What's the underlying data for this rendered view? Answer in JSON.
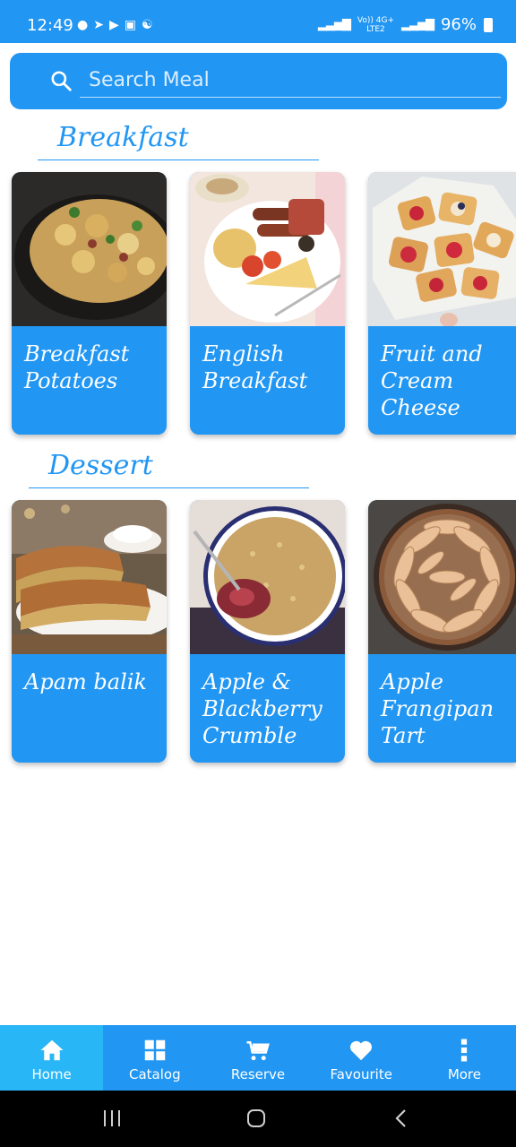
{
  "status_bar": {
    "time": "12:49",
    "battery": "96%",
    "network_top": "Vo)) 4G+",
    "network_bottom": "LTE2"
  },
  "search": {
    "placeholder": "Search Meal"
  },
  "sections": [
    {
      "title": "Breakfast",
      "meals": [
        {
          "name": "Breakfast Potatoes"
        },
        {
          "name": "English Breakfast"
        },
        {
          "name": "Fruit and Cream Cheese"
        }
      ]
    },
    {
      "title": "Dessert",
      "meals": [
        {
          "name": "Apam balik"
        },
        {
          "name": "Apple & Blackberry Crumble"
        },
        {
          "name": "Apple Frangipan Tart"
        }
      ]
    }
  ],
  "bottom_nav": {
    "items": [
      {
        "label": "Home",
        "icon": "home-icon",
        "active": true
      },
      {
        "label": "Catalog",
        "icon": "grid-icon",
        "active": false
      },
      {
        "label": "Reserve",
        "icon": "cart-icon",
        "active": false
      },
      {
        "label": "Favourite",
        "icon": "heart-icon",
        "active": false
      },
      {
        "label": "More",
        "icon": "more-vertical-icon",
        "active": false
      }
    ]
  },
  "colors": {
    "primary": "#2196F3",
    "active_nav": "#29B6F6"
  }
}
